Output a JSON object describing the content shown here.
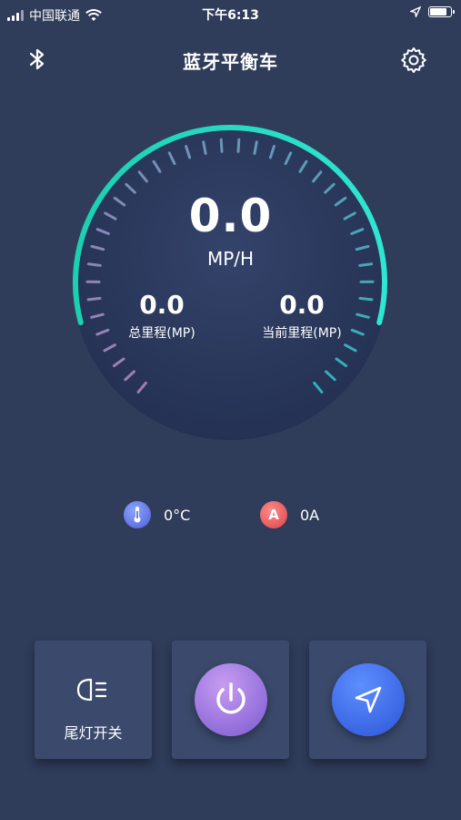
{
  "status_bar": {
    "carrier": "中国联通",
    "time": "下午6:13",
    "battery_level": 0.85
  },
  "header": {
    "title": "蓝牙平衡车",
    "bluetooth_icon": "bluetooth-icon",
    "settings_icon": "gear-icon"
  },
  "gauge": {
    "speed": "0.0",
    "speed_unit": "MP/H",
    "total_value": "0.0",
    "total_label": "总里程(MP)",
    "current_value": "0.0",
    "current_label": "当前里程(MP)",
    "colors": {
      "arc_start": "#1ccfb1",
      "arc_end": "#2fe6d2",
      "ticks_left": "#a27cb6",
      "ticks_right": "#2fb1b8"
    }
  },
  "info": {
    "temperature": "0°C",
    "amp_letter": "A",
    "amp_value": "0A"
  },
  "controls": {
    "tail_light_label": "尾灯开关",
    "tail_light_icon": "headlight-icon",
    "power_icon": "power-icon",
    "navigation_icon": "navigation-arrow-icon"
  }
}
